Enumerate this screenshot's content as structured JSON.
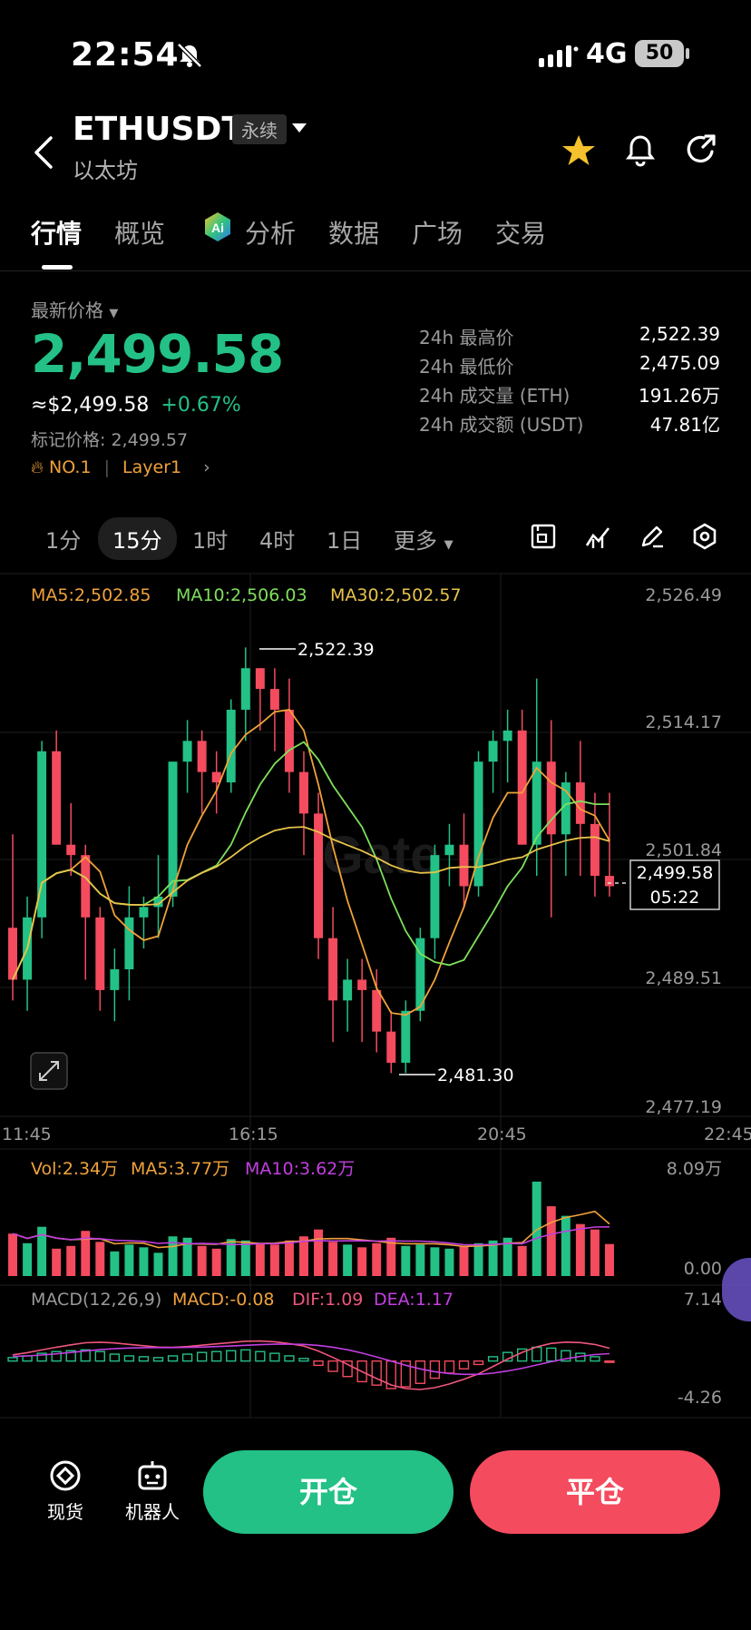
{
  "status_bar": {
    "time": "22:54",
    "network": "4G",
    "battery": "50"
  },
  "header": {
    "pair": "ETHUSDT",
    "contract_type": "永续",
    "subtitle": "以太坊"
  },
  "tabs": [
    {
      "label": "行情",
      "active": true
    },
    {
      "label": "概览"
    },
    {
      "label": "分析"
    },
    {
      "label": "数据"
    },
    {
      "label": "广场"
    },
    {
      "label": "交易"
    }
  ],
  "price": {
    "label": "最新价格",
    "last": "2,499.58",
    "usd": "≈$2,499.58",
    "change": "+0.67%",
    "mark": "标记价格: 2,499.57",
    "rank": "NO.1",
    "tag": "Layer1"
  },
  "stats": [
    {
      "k": "24h 最高价",
      "v": "2,522.39"
    },
    {
      "k": "24h 最低价",
      "v": "2,475.09"
    },
    {
      "k": "24h 成交量 (ETH)",
      "v": "191.26万"
    },
    {
      "k": "24h 成交额 (USDT)",
      "v": "47.81亿"
    }
  ],
  "timeframes": [
    "1分",
    "15分",
    "1时",
    "4时",
    "1日",
    "更多"
  ],
  "active_timeframe": "15分",
  "ma_legend": {
    "ma5": "MA5:2,502.85",
    "ma10": "MA10:2,506.03",
    "ma30": "MA30:2,502.57"
  },
  "price_axis": [
    "2,526.49",
    "2,514.17",
    "2,501.84",
    "2,489.51",
    "2,477.19"
  ],
  "time_axis": [
    "11:45",
    "16:15",
    "20:45",
    "22:45"
  ],
  "annotations": {
    "high": "2,522.39",
    "low": "2,481.30",
    "current_price": "2,499.58",
    "countdown": "05:22"
  },
  "volume": {
    "vol": "Vol:2.34万",
    "ma5": "MA5:3.77万",
    "ma10": "MA10:3.62万",
    "max": "8.09万",
    "min": "0.00"
  },
  "macd": {
    "label": "MACD(12,26,9)",
    "macd": "MACD:-0.08",
    "dif": "DIF:1.09",
    "dea": "DEA:1.17",
    "max": "7.14",
    "min": "-4.26"
  },
  "bottom": {
    "spot": "现货",
    "bot": "机器人",
    "open": "开仓",
    "close": "平仓"
  },
  "colors": {
    "up": "#23c186",
    "down": "#f44b5e",
    "ma5": "#f0a23a",
    "ma10": "#7ee05b",
    "ma30": "#e8c34a",
    "dea": "#c23fe0",
    "dif": "#f0567c"
  },
  "chart_data": {
    "type": "candlestick",
    "ylim": [
      2477.19,
      2526.49
    ],
    "candles": [
      [
        2495,
        2504,
        2488,
        2490
      ],
      [
        2490,
        2498,
        2487,
        2496
      ],
      [
        2496,
        2513,
        2494,
        2512
      ],
      [
        2512,
        2514,
        2504,
        2503
      ],
      [
        2503,
        2507,
        2500,
        2502
      ],
      [
        2502,
        2503,
        2490,
        2496
      ],
      [
        2496,
        2497,
        2487,
        2489
      ],
      [
        2489,
        2493,
        2486,
        2491
      ],
      [
        2491,
        2499,
        2488,
        2496
      ],
      [
        2496,
        2498,
        2493,
        2497
      ],
      [
        2497,
        2502,
        2494,
        2498
      ],
      [
        2498,
        2511,
        2497,
        2511
      ],
      [
        2511,
        2515,
        2508,
        2513
      ],
      [
        2513,
        2514,
        2506,
        2510
      ],
      [
        2510,
        2512,
        2506,
        2509
      ],
      [
        2509,
        2517,
        2508,
        2516
      ],
      [
        2516,
        2522,
        2513,
        2520
      ],
      [
        2520,
        2520,
        2514,
        2518
      ],
      [
        2518,
        2520,
        2512,
        2516
      ],
      [
        2516,
        2519,
        2508,
        2510
      ],
      [
        2510,
        2512,
        2502,
        2506
      ],
      [
        2506,
        2508,
        2492,
        2494
      ],
      [
        2494,
        2497,
        2484,
        2488
      ],
      [
        2488,
        2492,
        2485,
        2490
      ],
      [
        2490,
        2492,
        2484,
        2489
      ],
      [
        2489,
        2491,
        2483,
        2485
      ],
      [
        2485,
        2487,
        2481,
        2482
      ],
      [
        2482,
        2488,
        2481,
        2487
      ],
      [
        2487,
        2495,
        2486,
        2494
      ],
      [
        2494,
        2503,
        2492,
        2502
      ],
      [
        2502,
        2505,
        2499,
        2503
      ],
      [
        2503,
        2506,
        2497,
        2499
      ],
      [
        2499,
        2512,
        2498,
        2511
      ],
      [
        2511,
        2514,
        2508,
        2513
      ],
      [
        2513,
        2516,
        2509,
        2514
      ],
      [
        2514,
        2516,
        2505,
        2503
      ],
      [
        2503,
        2519,
        2500,
        2511
      ],
      [
        2511,
        2515,
        2496,
        2504
      ],
      [
        2504,
        2510,
        2500,
        2509
      ],
      [
        2509,
        2513,
        2500,
        2505
      ],
      [
        2505,
        2508,
        2498,
        2500
      ],
      [
        2500,
        2508,
        2498,
        2499
      ]
    ],
    "volume": [
      3.1,
      2.4,
      3.6,
      2.0,
      2.2,
      3.3,
      2.5,
      1.8,
      2.3,
      2.1,
      1.7,
      2.9,
      2.8,
      2.2,
      2.0,
      2.7,
      2.6,
      2.4,
      2.3,
      2.6,
      2.9,
      3.4,
      2.5,
      2.3,
      2.1,
      2.4,
      2.8,
      2.2,
      2.3,
      2.1,
      2.0,
      2.2,
      2.4,
      2.6,
      2.8,
      2.2,
      6.9,
      5.1,
      4.4,
      3.8,
      3.4,
      2.34
    ],
    "macd_hist": [
      0.4,
      0.6,
      0.9,
      1.1,
      1.2,
      1.3,
      1.1,
      0.8,
      0.6,
      0.5,
      0.4,
      0.6,
      0.8,
      1.0,
      1.1,
      1.2,
      1.3,
      1.1,
      0.9,
      0.6,
      0.3,
      -0.5,
      -1.2,
      -1.8,
      -2.4,
      -2.8,
      -3.2,
      -3.0,
      -2.6,
      -2.0,
      -1.4,
      -0.9,
      -0.4,
      0.5,
      1.0,
      1.4,
      1.6,
      1.5,
      1.2,
      0.9,
      0.5,
      -0.08
    ]
  }
}
